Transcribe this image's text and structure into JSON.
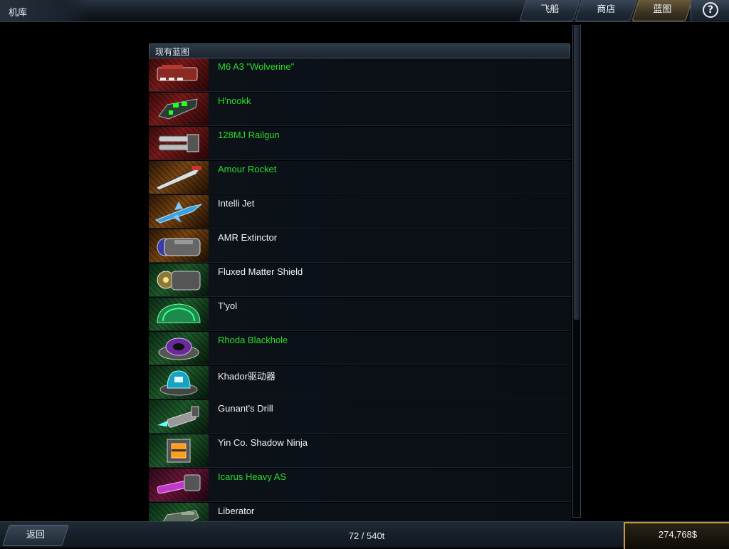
{
  "window": {
    "title": "机库"
  },
  "tabs": [
    {
      "label": "飞船",
      "active": false
    },
    {
      "label": "商店",
      "active": false
    },
    {
      "label": "蓝图",
      "active": true
    }
  ],
  "help": {
    "icon": "help-icon",
    "glyph": "?"
  },
  "section": {
    "title": "现有蓝图"
  },
  "blueprints": [
    {
      "name": "M6 A3 \"Wolverine\"",
      "color": "#2bdc2b",
      "icon": "cannon-icon",
      "bg": "red"
    },
    {
      "name": "H'nookk",
      "color": "#2bdc2b",
      "icon": "alien-cannon-icon",
      "bg": "red"
    },
    {
      "name": "128MJ Railgun",
      "color": "#2bdc2b",
      "icon": "railgun-icon",
      "bg": "red"
    },
    {
      "name": "Amour Rocket",
      "color": "#2bdc2b",
      "icon": "rocket-icon",
      "bg": "orange"
    },
    {
      "name": "Intelli Jet",
      "color": "#f2f2f2",
      "icon": "jet-icon",
      "bg": "orange"
    },
    {
      "name": "AMR Extinctor",
      "color": "#f2f2f2",
      "icon": "torpedo-launcher-icon",
      "bg": "orange"
    },
    {
      "name": "Fluxed Matter Shield",
      "color": "#f2f2f2",
      "icon": "shield-icon",
      "bg": "green"
    },
    {
      "name": "T'yol",
      "color": "#f2f2f2",
      "icon": "alien-shield-icon",
      "bg": "green"
    },
    {
      "name": "Rhoda Blackhole",
      "color": "#2bdc2b",
      "icon": "blackhole-device-icon",
      "bg": "green"
    },
    {
      "name": "Khador驱动器",
      "color": "#f2f2f2",
      "icon": "drive-icon",
      "bg": "green"
    },
    {
      "name": "Gunant's Drill",
      "color": "#f2f2f2",
      "icon": "drill-icon",
      "bg": "green"
    },
    {
      "name": "Yin Co. Shadow Ninja",
      "color": "#f2f2f2",
      "icon": "cloak-module-icon",
      "bg": "green"
    },
    {
      "name": "Icarus Heavy AS",
      "color": "#2bdc2b",
      "icon": "heavy-cannon-icon",
      "bg": "pink"
    },
    {
      "name": "Liberator",
      "color": "#f2f2f2",
      "icon": "missile-pod-icon",
      "bg": "green"
    }
  ],
  "footer": {
    "back_label": "返回",
    "capacity": "72 / 540t",
    "credits": "274,768$"
  },
  "colors": {
    "acquired": "#2bdc2b",
    "normal": "#f2f2f2",
    "accent_gold": "#c79a3c"
  }
}
